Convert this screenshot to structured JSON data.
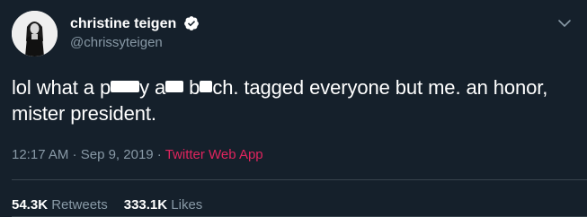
{
  "author": {
    "display_name": "christine teigen",
    "handle": "@chrissyteigen",
    "verified": true
  },
  "tweet": {
    "segments": [
      "lol what a p",
      "y a",
      " b",
      "ch. tagged everyone but me. an honor, mister president."
    ],
    "redactions": 3
  },
  "meta": {
    "time": "12:17 AM",
    "sep1": " · ",
    "date": "Sep 9, 2019",
    "sep2": " · ",
    "source": "Twitter Web App"
  },
  "stats": {
    "retweets_count": "54.3K",
    "retweets_label": " Retweets",
    "likes_count": "333.1K",
    "likes_label": " Likes"
  },
  "colors": {
    "background": "#15202b",
    "secondary_text": "#8899a6",
    "source_link": "#e0245e",
    "verified_badge": "#ffffff",
    "divider": "#38444d"
  }
}
